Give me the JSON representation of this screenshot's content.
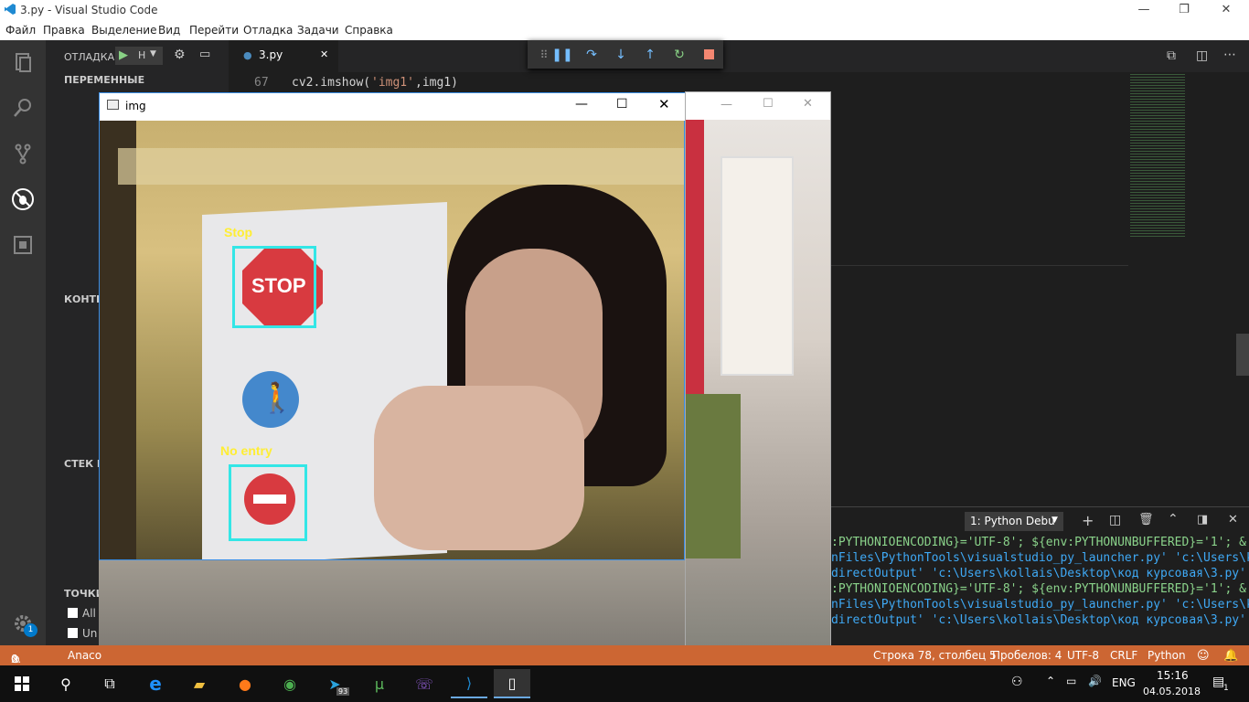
{
  "window": {
    "title": "3.py - Visual Studio Code",
    "minimize": "—",
    "maximize": "❐",
    "close": "✕"
  },
  "menu": [
    "Файл",
    "Правка",
    "Выделение",
    "Вид",
    "Перейти",
    "Отладка",
    "Задачи",
    "Справка"
  ],
  "sidebar": {
    "debug_label": "ОТЛАДКА",
    "config": "Н",
    "sections": [
      "ПЕРЕМЕННЫЕ",
      "КОНТР",
      "СТЕК В",
      "ТОЧКИ"
    ],
    "breakpoints": [
      "All",
      "Un"
    ]
  },
  "editor": {
    "tab": "3.py",
    "line_number": "67",
    "code_fn": "cv2.imshow(",
    "code_str": "'img1'",
    "code_rest": ",img1)"
  },
  "cam": {
    "title": "img",
    "labels": [
      "Stop",
      "No entry"
    ],
    "stop_text": "STOP"
  },
  "panel": {
    "dropdown": "1: Python Debu",
    "lines": [
      ":PYTHONIOENCODING}='UTF-8'; ${env:PYTHONUNBUFFERED}='1'; & 'D:",
      "nFiles\\PythonTools\\visualstudio_py_launcher.py' 'c:\\Users\\koll",
      "directOutput' 'c:\\Users\\kollais\\Desktop\\код курсовая\\3.py'",
      ":PYTHONIOENCODING}='UTF-8'; ${env:PYTHONUNBUFFERED}='1'; & 'D:",
      "nFiles\\PythonTools\\visualstudio_py_launcher.py' 'c:\\Users\\koll",
      "directOutput' 'c:\\Users\\kollais\\Desktop\\код курсовая\\3.py'"
    ]
  },
  "status": {
    "errors": "0",
    "warnings": "0",
    "user": "Anaco",
    "position": "Строка 78, столбец 5",
    "spaces": "Пробелов: 4",
    "encoding": "UTF-8",
    "eol": "CRLF",
    "language": "Python",
    "badge": "1"
  },
  "taskbar": {
    "lang": "ENG",
    "time": "15:16",
    "date": "04.05.2018",
    "telegram_badge": "93",
    "notifications": "1"
  },
  "colors": {
    "accent": "#cc6633",
    "box": "#33e6e6",
    "label": "#ffee33"
  }
}
